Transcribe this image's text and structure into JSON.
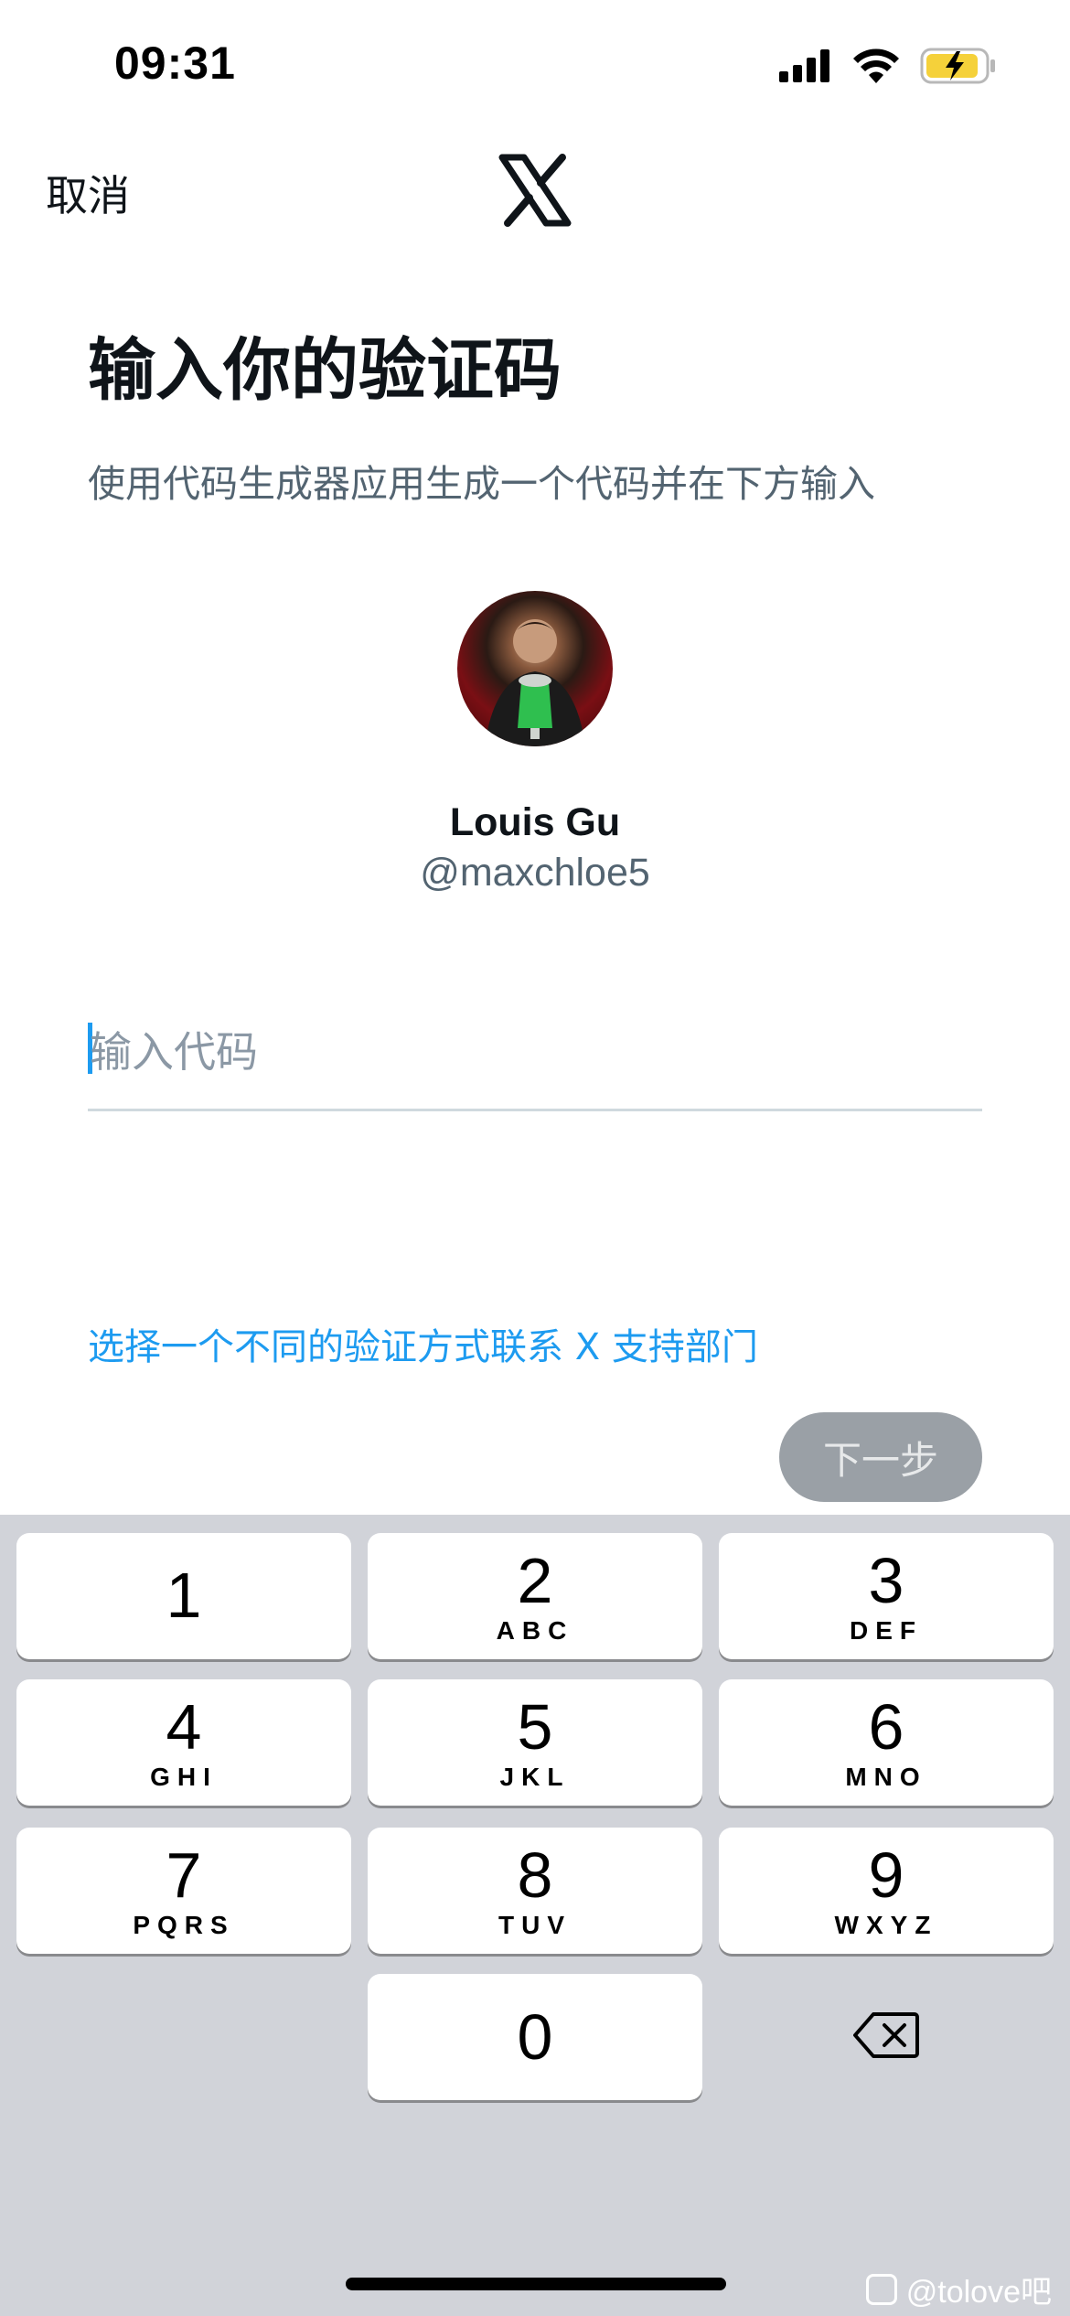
{
  "status_bar": {
    "time": "09:31",
    "icons": [
      "signal-icon",
      "wifi-icon",
      "battery-charging-icon"
    ],
    "battery_color": "#f5d13a"
  },
  "nav": {
    "cancel_label": "取消",
    "logo": "x-logo-icon"
  },
  "header": {
    "title": "输入你的验证码",
    "subtitle": "使用代码生成器应用生成一个代码并在下方输入"
  },
  "user": {
    "name": "Louis Gu",
    "handle": "@maxchloe5"
  },
  "code_input": {
    "placeholder": "输入代码",
    "value": ""
  },
  "links": {
    "alt_method_label": "选择一个不同的验证方式联系 X 支持部门"
  },
  "actions": {
    "next_label": "下一步"
  },
  "keypad": {
    "keys": [
      {
        "digit": "1",
        "letters": ""
      },
      {
        "digit": "2",
        "letters": "ABC"
      },
      {
        "digit": "3",
        "letters": "DEF"
      },
      {
        "digit": "4",
        "letters": "GHI"
      },
      {
        "digit": "5",
        "letters": "JKL"
      },
      {
        "digit": "6",
        "letters": "MNO"
      },
      {
        "digit": "7",
        "letters": "PQRS"
      },
      {
        "digit": "8",
        "letters": "TUV"
      },
      {
        "digit": "9",
        "letters": "WXYZ"
      },
      {
        "digit": "0",
        "letters": ""
      }
    ],
    "delete_icon": "backspace-icon"
  },
  "watermark": {
    "text": "@tolove吧"
  },
  "colors": {
    "accent": "#1d9bf0",
    "secondary_text": "#536471",
    "disabled_button": "#9aa0a6",
    "keyboard_bg": "#d1d3d9"
  }
}
